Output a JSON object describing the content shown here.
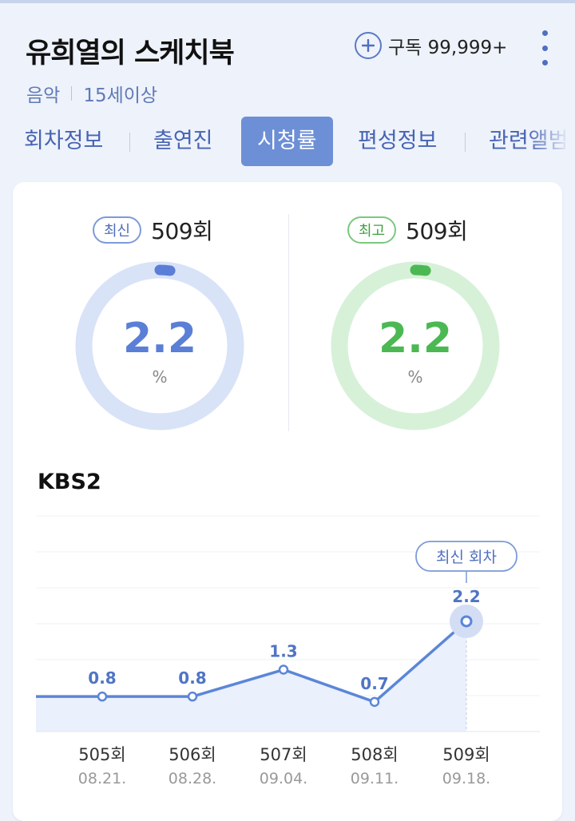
{
  "header": {
    "title": "유희열의 스케치북",
    "genre": "음악",
    "age": "15세이상",
    "subscribe_label": "구독 99,999+"
  },
  "tabs": [
    {
      "label": "회차정보",
      "active": false
    },
    {
      "label": "출연진",
      "active": false
    },
    {
      "label": "시청률",
      "active": true
    },
    {
      "label": "편성정보",
      "active": false
    },
    {
      "label": "관련앨범",
      "active": false
    }
  ],
  "ratings": {
    "latest": {
      "badge": "최신",
      "episode": "509회",
      "value": "2.2",
      "unit": "%",
      "fraction": 0.022,
      "color": "#5b7fd6",
      "track": "#d9e3f7"
    },
    "highest": {
      "badge": "최고",
      "episode": "509회",
      "value": "2.2",
      "unit": "%",
      "fraction": 0.022,
      "color": "#4cb853",
      "track": "#d7f1d9"
    }
  },
  "channel": "KBS2",
  "chart_data": {
    "type": "line",
    "categories": [
      "505회",
      "506회",
      "507회",
      "508회",
      "509회"
    ],
    "dates": [
      "08.21.",
      "08.28.",
      "09.04.",
      "09.11.",
      "09.18."
    ],
    "values": [
      0.8,
      0.8,
      1.3,
      0.7,
      2.2
    ],
    "highlight_label": "최신 회차",
    "line_color": "#5b86d8"
  }
}
